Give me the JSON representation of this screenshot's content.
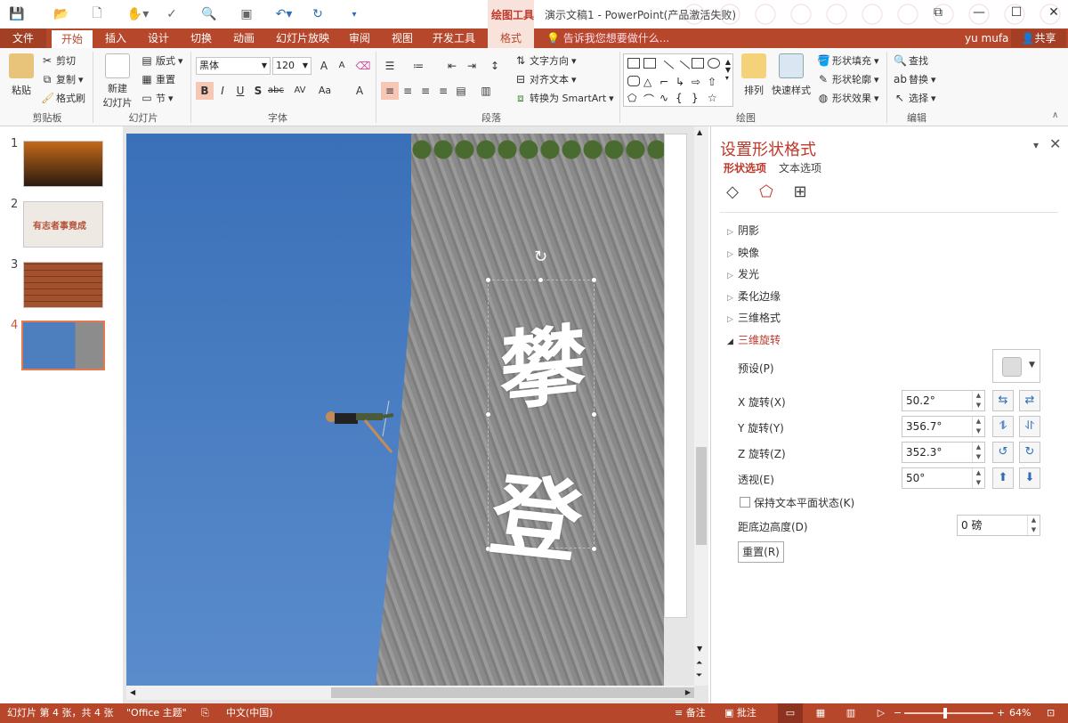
{
  "titlebar": {
    "document_title": "演示文稿1 - PowerPoint(产品激活失败)",
    "contextual_tools": "绘图工具",
    "window_controls": {
      "help": "?",
      "restore": "⧉",
      "minimize": "—",
      "maximize": "☐",
      "close": "✕"
    }
  },
  "tabs": {
    "file": "文件",
    "home": "开始",
    "insert": "插入",
    "design": "设计",
    "transitions": "切换",
    "animations": "动画",
    "slideshow": "幻灯片放映",
    "review": "审阅",
    "view": "视图",
    "developer": "开发工具",
    "format": "格式",
    "tell_me": "告诉我您想要做什么...",
    "user": "yu mufa",
    "share": "共享"
  },
  "ribbon": {
    "clipboard": {
      "paste": "粘贴",
      "cut": "剪切",
      "copy": "复制",
      "format_painter": "格式刷",
      "label": "剪贴板"
    },
    "slides": {
      "new_slide_line1": "新建",
      "new_slide_line2": "幻灯片",
      "layout": "版式",
      "reset": "重置",
      "section": "节",
      "label": "幻灯片"
    },
    "font": {
      "name": "黑体",
      "size": "120",
      "label": "字体",
      "bold": "B",
      "italic": "I",
      "underline": "U",
      "shadow": "S",
      "strike": "abc",
      "spacing": "AV",
      "case": "Aa",
      "color": "A",
      "grow": "A",
      "shrink": "A"
    },
    "paragraph": {
      "text_direction": "文字方向",
      "align_text": "对齐文本",
      "smartart": "转换为 SmartArt",
      "label": "段落"
    },
    "drawing": {
      "arrange": "排列",
      "quick_styles": "快速样式",
      "shape_fill": "形状填充",
      "shape_outline": "形状轮廓",
      "shape_effects": "形状效果",
      "label": "绘图"
    },
    "editing": {
      "find": "查找",
      "replace": "替换",
      "select": "选择",
      "label": "编辑"
    }
  },
  "thumbnails": [
    {
      "number": "1",
      "text": ""
    },
    {
      "number": "2",
      "text": "有志者事竟成"
    },
    {
      "number": "3",
      "text": ""
    },
    {
      "number": "4",
      "text": ""
    }
  ],
  "slide": {
    "char1": "攀",
    "char2": "登"
  },
  "format_pane": {
    "title": "设置形状格式",
    "tab_shape": "形状选项",
    "tab_text": "文本选项",
    "sections": {
      "shadow": "阴影",
      "reflection": "映像",
      "glow": "发光",
      "soft_edges": "柔化边缘",
      "format_3d": "三维格式",
      "rotation_3d": "三维旋转"
    },
    "preset_label": "预设(P)",
    "x_label": "X 旋转(X)",
    "x_value": "50.2°",
    "y_label": "Y 旋转(Y)",
    "y_value": "356.7°",
    "z_label": "Z 旋转(Z)",
    "z_value": "352.3°",
    "perspective_label": "透视(E)",
    "perspective_value": "50°",
    "keep_text_flat": "保持文本平面状态(K)",
    "distance_label": "距底边高度(D)",
    "distance_value": "0 磅",
    "reset": "重置(R)"
  },
  "statusbar": {
    "slide_info": "幻灯片 第 4 张，共 4 张",
    "theme": "\"Office 主题\"",
    "language": "中文(中国)",
    "notes": "备注",
    "comments": "批注",
    "zoom": "64%"
  },
  "colors": {
    "accent": "#b7472a",
    "pane_title": "#c0392b",
    "sky": "#4d7fbf"
  }
}
